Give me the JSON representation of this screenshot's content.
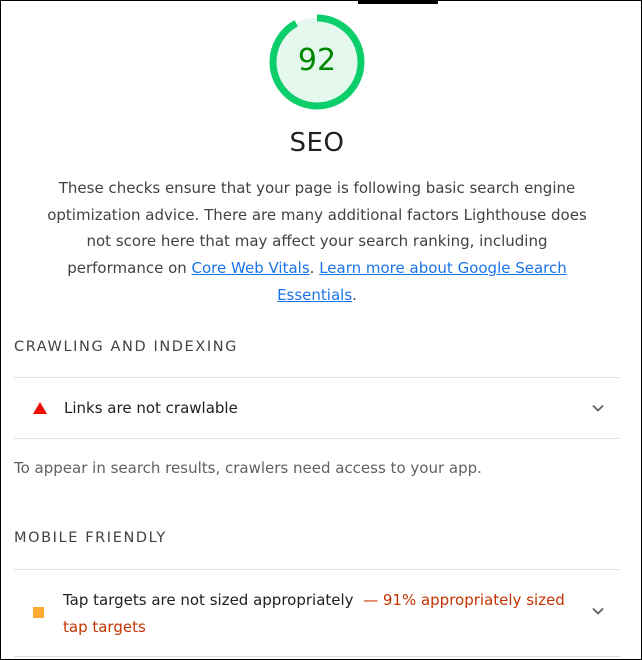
{
  "category": {
    "score": "92",
    "score_fraction": 0.92,
    "score_color": "#0cce6b",
    "title": "SEO",
    "description": {
      "text_before": "These checks ensure that your page is following basic search engine optimization advice. There are many additional factors Lighthouse does not score here that may affect your search ranking, including performance on ",
      "link1": "Core Web Vitals",
      "text_between": ". ",
      "link2": "Learn more about Google Search Essentials",
      "text_after": "."
    }
  },
  "groups": [
    {
      "title": "CRAWLING AND INDEXING",
      "audits": [
        {
          "title": "Links are not crawlable",
          "display_value": "",
          "status_icon": "fail-triangle-icon"
        }
      ],
      "description": "To appear in search results, crawlers need access to your app."
    },
    {
      "title": "MOBILE FRIENDLY",
      "audits": [
        {
          "title": "Tap targets are not sized appropriately",
          "display_value": "— 91% appropriately sized tap targets",
          "status_icon": "average-square-icon"
        }
      ]
    }
  ],
  "colors": {
    "pass": "#0cce6b",
    "pass_text": "#008800",
    "fail": "#eb0f00",
    "average": "#ffaa33",
    "link": "#1a73e8",
    "warning_text": "#c33300"
  }
}
